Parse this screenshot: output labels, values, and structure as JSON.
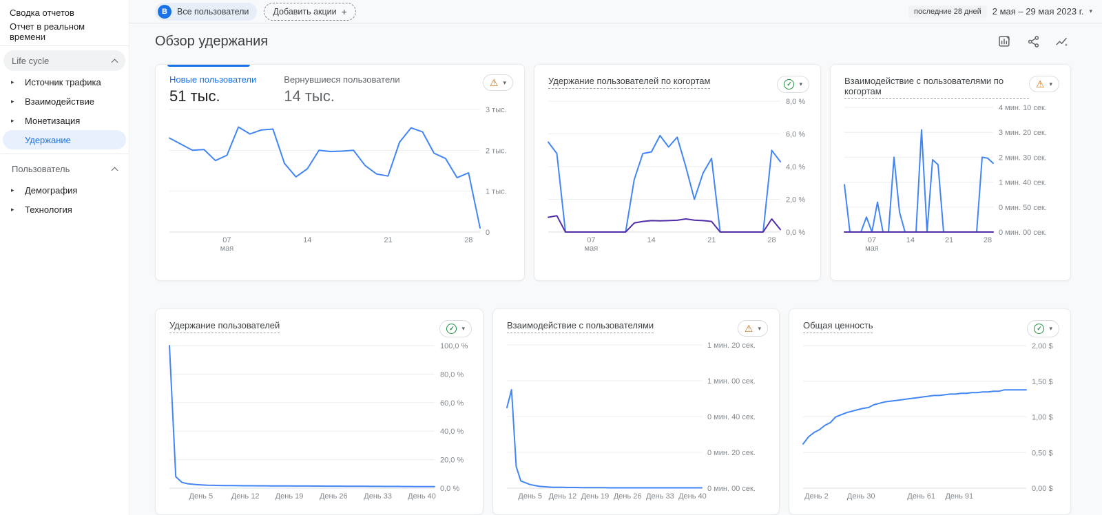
{
  "page": {
    "title": "Обзор удержания"
  },
  "icons": {
    "warning": "⚠",
    "check": "✓",
    "plus": "+",
    "caret": "▾",
    "expand": "▸"
  },
  "colors": {
    "accent": "#1a73e8",
    "line_blue": "#4285f4",
    "line_purple": "#512da8",
    "warning": "#d56e0c",
    "ok": "#1e8e3e"
  },
  "topbar": {
    "audience_letter": "B",
    "audience_label": "Все пользователи",
    "add_label": "Добавить акции",
    "date_preset": "последние 28 дней",
    "date_value": "2 мая – 29 мая 2023 г."
  },
  "sidebar": {
    "items_top": [
      "Сводка отчетов",
      "Отчет в реальном времени"
    ],
    "sections": [
      {
        "label": "Life cycle",
        "items": [
          {
            "label": "Источник трафика",
            "expandable": true
          },
          {
            "label": "Взаимодействие",
            "expandable": true
          },
          {
            "label": "Монетизация",
            "expandable": true
          },
          {
            "label": "Удержание",
            "selected": true
          }
        ]
      },
      {
        "label": "Пользователь",
        "items": [
          {
            "label": "Демография",
            "expandable": true
          },
          {
            "label": "Технология",
            "expandable": true
          }
        ]
      }
    ]
  },
  "chart_data": [
    {
      "type": "line",
      "tabs": [
        {
          "label": "Новые пользователи",
          "value": "51 тыс."
        },
        {
          "label": "Вернувшиеся пользователи",
          "value": "14 тыс."
        }
      ],
      "status": "warning",
      "ymax": 3,
      "y_ticks": [
        "3 тыс.",
        "2 тыс.",
        "1 тыс.",
        "0"
      ],
      "x_ticks": [
        {
          "label": "07",
          "sub": "мая",
          "pos": 0.185
        },
        {
          "label": "14",
          "pos": 0.444
        },
        {
          "label": "21",
          "pos": 0.704
        },
        {
          "label": "28",
          "pos": 0.963
        }
      ],
      "series": [
        {
          "color": "#4285f4",
          "values": [
            2.3,
            2.15,
            2.0,
            2.02,
            1.75,
            1.88,
            2.57,
            2.4,
            2.5,
            2.52,
            1.68,
            1.35,
            1.55,
            2.0,
            1.97,
            1.98,
            2.0,
            1.63,
            1.42,
            1.37,
            2.2,
            2.55,
            2.45,
            1.93,
            1.8,
            1.33,
            1.45,
            0.1
          ]
        }
      ]
    },
    {
      "type": "line",
      "title": "Удержание пользователей по когортам",
      "status": "ok",
      "ymax": 8,
      "y_ticks": [
        "8,0 %",
        "6,0 %",
        "4,0 %",
        "2,0 %",
        "0,0 %"
      ],
      "x_ticks": [
        {
          "label": "07",
          "sub": "мая",
          "pos": 0.185
        },
        {
          "label": "14",
          "pos": 0.444
        },
        {
          "label": "21",
          "pos": 0.704
        },
        {
          "label": "28",
          "pos": 0.963
        }
      ],
      "series": [
        {
          "color": "#4285f4",
          "values": [
            5.5,
            4.8,
            0,
            0,
            0,
            0,
            0,
            0,
            0,
            0,
            3.2,
            4.8,
            4.9,
            5.9,
            5.2,
            5.8,
            4.0,
            2.0,
            3.6,
            4.5,
            0,
            0,
            0,
            0,
            0,
            0,
            5.0,
            4.3
          ]
        },
        {
          "color": "#512da8",
          "values": [
            0.9,
            1.0,
            0,
            0,
            0,
            0,
            0,
            0,
            0,
            0,
            0.55,
            0.65,
            0.7,
            0.68,
            0.7,
            0.72,
            0.8,
            0.73,
            0.7,
            0.65,
            0,
            0,
            0,
            0,
            0,
            0,
            0.8,
            0.15
          ]
        }
      ]
    },
    {
      "type": "line",
      "title": "Взаимодействие с пользователями по когортам",
      "status": "warning",
      "ymax": 250,
      "y_ticks": [
        "4 мин. 10 сек.",
        "3 мин. 20 сек.",
        "2 мин. 30 сек.",
        "1 мин. 40 сек.",
        "0 мин. 50 сек.",
        "0 мин. 00 сек."
      ],
      "x_ticks": [
        {
          "label": "07",
          "sub": "мая",
          "pos": 0.185
        },
        {
          "label": "14",
          "pos": 0.444
        },
        {
          "label": "21",
          "pos": 0.704
        },
        {
          "label": "28",
          "pos": 0.963
        }
      ],
      "series": [
        {
          "color": "#4285f4",
          "values": [
            95,
            0,
            0,
            0,
            30,
            0,
            60,
            0,
            0,
            150,
            40,
            0,
            0,
            0,
            205,
            0,
            145,
            135,
            0,
            0,
            0,
            0,
            0,
            0,
            0,
            150,
            148,
            138
          ]
        },
        {
          "color": "#512da8",
          "values": [
            0,
            0,
            0,
            0,
            0,
            0,
            0,
            0,
            0,
            0,
            0,
            0,
            0,
            0,
            0,
            0,
            0,
            0,
            0,
            0,
            0,
            0,
            0,
            0,
            0,
            0,
            0,
            0
          ]
        }
      ]
    },
    {
      "type": "line",
      "title": "Удержание пользователей",
      "status": "ok",
      "ymax": 100,
      "y_ticks": [
        "100,0 %",
        "80,0 %",
        "60,0 %",
        "40,0 %",
        "20,0 %",
        "0,0 %"
      ],
      "x_ticks": [
        {
          "label": "День 5",
          "pos": 0.119
        },
        {
          "label": "День 12",
          "pos": 0.286
        },
        {
          "label": "День 19",
          "pos": 0.452
        },
        {
          "label": "День 26",
          "pos": 0.619
        },
        {
          "label": "День 33",
          "pos": 0.786
        },
        {
          "label": "День 40",
          "pos": 0.952
        }
      ],
      "series": [
        {
          "color": "#4285f4",
          "values": [
            100,
            8,
            4,
            3,
            2.6,
            2.3,
            2.1,
            2.0,
            1.9,
            1.85,
            1.8,
            1.75,
            1.7,
            1.68,
            1.65,
            1.62,
            1.6,
            1.58,
            1.55,
            1.53,
            1.5,
            1.5,
            1.48,
            1.45,
            1.43,
            1.4,
            1.4,
            1.38,
            1.35,
            1.33,
            1.3,
            1.3,
            1.28,
            1.25,
            1.23,
            1.2,
            1.2,
            1.18,
            1.15,
            1.13,
            1.1,
            1.1,
            1.08
          ]
        }
      ]
    },
    {
      "type": "line",
      "title": "Взаимодействие с пользователями",
      "status": "warning",
      "ymax": 80,
      "y_ticks": [
        "1 мин. 20 сек.",
        "1 мин. 00 сек.",
        "0 мин. 40 сек.",
        "0 мин. 20 сек.",
        "0 мин. 00 сек."
      ],
      "x_ticks": [
        {
          "label": "День 5",
          "pos": 0.119
        },
        {
          "label": "День 12",
          "pos": 0.286
        },
        {
          "label": "День 19",
          "pos": 0.452
        },
        {
          "label": "День 26",
          "pos": 0.619
        },
        {
          "label": "День 33",
          "pos": 0.786
        },
        {
          "label": "День 40",
          "pos": 0.952
        }
      ],
      "series": [
        {
          "color": "#4285f4",
          "values": [
            45,
            55,
            12,
            4,
            3,
            2,
            1.5,
            1,
            0.8,
            0.6,
            0.5,
            0.5,
            0.5,
            0.4,
            0.4,
            0.4,
            0.3,
            0.3,
            0.3,
            0.3,
            0.3,
            0.3,
            0.2,
            0.2,
            0.2,
            0.2,
            0.2,
            0.2,
            0.2,
            0.2,
            0.2,
            0.2,
            0.2,
            0.2,
            0.2,
            0.2,
            0.2,
            0.2,
            0.2,
            0.2,
            0.2,
            0.2,
            0.2
          ]
        }
      ]
    },
    {
      "type": "line",
      "title": "Общая ценность",
      "status": "ok",
      "ymax": 2,
      "y_ticks": [
        "2,00 $",
        "1,50 $",
        "1,00 $",
        "0,50 $",
        "0,00 $"
      ],
      "x_ticks": [
        {
          "label": "День 2",
          "pos": 0.06
        },
        {
          "label": "День 30",
          "pos": 0.26
        },
        {
          "label": "День 61",
          "pos": 0.53
        },
        {
          "label": "День 91",
          "pos": 0.7
        }
      ],
      "series": [
        {
          "color": "#4285f4",
          "values": [
            0.62,
            0.72,
            0.78,
            0.82,
            0.88,
            0.92,
            1.0,
            1.03,
            1.06,
            1.08,
            1.1,
            1.12,
            1.13,
            1.17,
            1.19,
            1.21,
            1.22,
            1.23,
            1.24,
            1.25,
            1.26,
            1.27,
            1.28,
            1.29,
            1.3,
            1.3,
            1.31,
            1.32,
            1.32,
            1.33,
            1.33,
            1.34,
            1.34,
            1.35,
            1.35,
            1.36,
            1.36,
            1.38,
            1.38,
            1.38,
            1.38,
            1.38
          ]
        }
      ]
    }
  ]
}
